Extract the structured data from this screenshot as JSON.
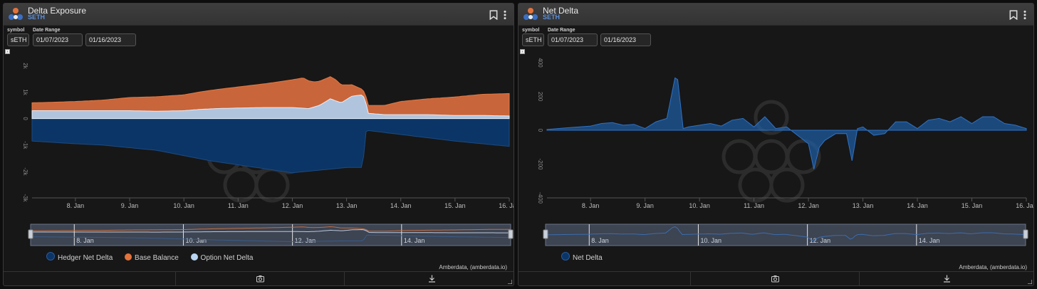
{
  "panels": [
    {
      "title": "Delta Exposure",
      "subtitle": "SETH",
      "symbol_label": "symbol",
      "symbol_value": "sETH",
      "date_range_label": "Date Range",
      "date_start": "01/07/2023",
      "date_end": "01/16/2023",
      "credits": "Amberdata, (amberdata.io)"
    },
    {
      "title": "Net Delta",
      "subtitle": "SETH",
      "symbol_label": "symbol",
      "symbol_value": "sETH",
      "date_range_label": "Date Range",
      "date_start": "01/07/2023",
      "date_end": "01/16/2023",
      "credits": "Amberdata, (amberdata.io)"
    }
  ],
  "colors": {
    "hedger": "#0a3566",
    "base": "#c9653a",
    "option": "#b0c4de",
    "net": "#1f5fa8"
  },
  "chart_data": [
    {
      "type": "area",
      "x_ticks": [
        "8. Jan",
        "9. Jan",
        "10. Jan",
        "11. Jan",
        "12. Jan",
        "13. Jan",
        "14. Jan",
        "15. Jan",
        "16. Jan"
      ],
      "x_tick_values": [
        8,
        9,
        10,
        11,
        12,
        13,
        14,
        15,
        16
      ],
      "xlim": [
        7.2,
        16.0
      ],
      "ylim": [
        -3,
        2.2
      ],
      "y_ticks": [
        "2k",
        "1k",
        "0",
        "-1k",
        "-2k",
        "-3k"
      ],
      "y_tick_values": [
        2,
        1,
        0,
        -1,
        -2,
        -3
      ],
      "navigator_labels": [
        "8. Jan",
        "10. Jan",
        "12. Jan",
        "14. Jan"
      ],
      "navigator_values": [
        8,
        10,
        12,
        14
      ],
      "series": [
        {
          "name": "Option Net Delta",
          "stack_bottom": true,
          "x": [
            7.2,
            7.6,
            8.0,
            8.5,
            9.0,
            9.5,
            10.0,
            10.3,
            10.6,
            11.0,
            11.5,
            12.0,
            12.3,
            12.5,
            12.7,
            12.9,
            13.1,
            13.3,
            13.35,
            13.4,
            13.7,
            14.0,
            14.5,
            15.0,
            15.5,
            16.0
          ],
          "values": [
            0.3,
            0.3,
            0.3,
            0.3,
            0.3,
            0.28,
            0.3,
            0.35,
            0.38,
            0.4,
            0.42,
            0.42,
            0.38,
            0.5,
            0.75,
            0.6,
            0.85,
            0.9,
            0.65,
            0.2,
            0.15,
            0.15,
            0.15,
            0.12,
            0.12,
            0.1
          ]
        },
        {
          "name": "Base Balance",
          "x": [
            7.2,
            7.6,
            8.0,
            8.5,
            9.0,
            9.5,
            10.0,
            10.5,
            11.0,
            11.5,
            12.0,
            12.2,
            12.4,
            12.8,
            13.0,
            13.3,
            13.4,
            13.7,
            14.0,
            14.5,
            15.0,
            15.5,
            16.0
          ],
          "values": [
            0.3,
            0.32,
            0.35,
            0.4,
            0.5,
            0.55,
            0.6,
            0.7,
            0.8,
            0.9,
            1.05,
            1.15,
            0.95,
            0.8,
            0.55,
            0.2,
            0.3,
            0.35,
            0.5,
            0.6,
            0.7,
            0.8,
            0.85
          ]
        },
        {
          "name": "Hedger Net Delta",
          "x": [
            7.2,
            7.6,
            8.0,
            8.5,
            9.0,
            9.5,
            10.0,
            10.5,
            11.0,
            11.5,
            12.0,
            12.5,
            13.0,
            13.3,
            13.35,
            13.4,
            13.8,
            14.2,
            14.6,
            15.0,
            15.5,
            16.0
          ],
          "values": [
            -0.85,
            -0.9,
            -0.95,
            -1.0,
            -1.1,
            -1.2,
            -1.4,
            -1.6,
            -1.75,
            -1.9,
            -2.05,
            -1.95,
            -1.85,
            -1.85,
            -0.5,
            -0.45,
            -0.55,
            -0.65,
            -0.75,
            -0.85,
            -0.95,
            -1.05
          ]
        }
      ],
      "legend": [
        "Hedger Net Delta",
        "Base Balance",
        "Option Net Delta"
      ],
      "legend_position": "bottom-left",
      "grid": false
    },
    {
      "type": "area",
      "x_ticks": [
        "8. Jan",
        "9. Jan",
        "10. Jan",
        "11. Jan",
        "12. Jan",
        "13. Jan",
        "14. Jan",
        "15. Jan",
        "16. Jan"
      ],
      "x_tick_values": [
        8,
        9,
        10,
        11,
        12,
        13,
        14,
        15,
        16
      ],
      "xlim": [
        7.2,
        16.0
      ],
      "ylim": [
        -400,
        400
      ],
      "y_ticks": [
        "400",
        "200",
        "0",
        "-200",
        "-400"
      ],
      "y_tick_values": [
        400,
        200,
        0,
        -200,
        -400
      ],
      "navigator_labels": [
        "8. Jan",
        "10. Jan",
        "12. Jan",
        "14. Jan"
      ],
      "navigator_values": [
        8,
        10,
        12,
        14
      ],
      "series": [
        {
          "name": "Net Delta",
          "x": [
            7.2,
            7.4,
            7.6,
            7.8,
            8.0,
            8.2,
            8.4,
            8.6,
            8.8,
            9.0,
            9.2,
            9.4,
            9.55,
            9.6,
            9.7,
            9.8,
            10.0,
            10.2,
            10.4,
            10.6,
            10.8,
            11.0,
            11.2,
            11.4,
            11.6,
            11.8,
            12.0,
            12.1,
            12.2,
            12.3,
            12.5,
            12.7,
            12.8,
            12.9,
            13.0,
            13.2,
            13.4,
            13.6,
            13.8,
            14.0,
            14.2,
            14.4,
            14.6,
            14.8,
            15.0,
            15.2,
            15.4,
            15.6,
            15.8,
            16.0
          ],
          "values": [
            5,
            10,
            15,
            20,
            25,
            40,
            45,
            30,
            35,
            10,
            50,
            70,
            310,
            300,
            10,
            20,
            30,
            40,
            25,
            60,
            70,
            20,
            80,
            10,
            20,
            -30,
            -80,
            -230,
            -100,
            -60,
            -20,
            -20,
            -180,
            10,
            20,
            -30,
            -20,
            50,
            50,
            10,
            60,
            70,
            50,
            80,
            40,
            80,
            80,
            40,
            30,
            10
          ]
        }
      ],
      "legend": [
        "Net Delta"
      ],
      "legend_position": "bottom-left",
      "grid": false
    }
  ]
}
